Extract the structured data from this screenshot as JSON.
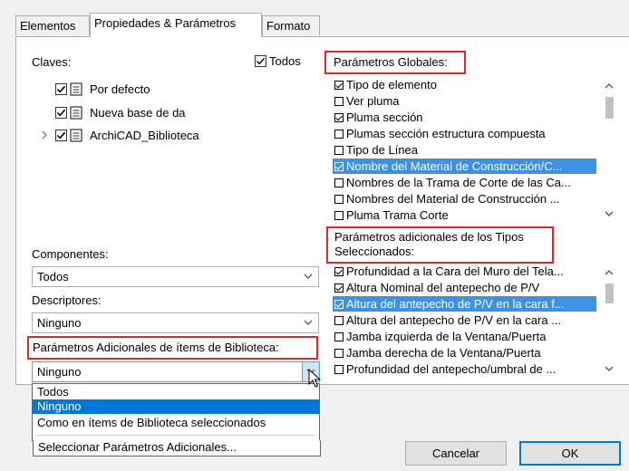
{
  "tabs": [
    {
      "label": "Elementos",
      "active": false
    },
    {
      "label": "Propiedades & Parámetros",
      "active": true
    },
    {
      "label": "Formato",
      "active": false
    }
  ],
  "left": {
    "keys_label": "Claves:",
    "all_label": "Todos",
    "all_checked": true,
    "tree": [
      {
        "label": "Por defecto",
        "checked": true,
        "expandable": false
      },
      {
        "label": "Nueva base de da",
        "checked": true,
        "expandable": false
      },
      {
        "label": "ArchiCAD_Biblioteca",
        "checked": true,
        "expandable": true
      }
    ],
    "components_label": "Componentes:",
    "components_value": "Todos",
    "descriptors_label": "Descriptores:",
    "descriptors_value": "Ninguno",
    "additional_label": "Parámetros Adicionales de ítems de Biblioteca:",
    "additional_value": "Ninguno",
    "dropdown_options": [
      "Todos",
      "Ninguno",
      "Como en ítems de Biblioteca seleccionados",
      "Seleccionar Parámetros Adicionales..."
    ],
    "dropdown_selected_index": 1
  },
  "global_params": {
    "title": "Parámetros Globales:",
    "items": [
      {
        "label": "Tipo de elemento",
        "checked": true,
        "selected": false
      },
      {
        "label": "Ver pluma",
        "checked": false,
        "selected": false
      },
      {
        "label": "Pluma sección",
        "checked": true,
        "selected": false
      },
      {
        "label": "Plumas sección estructura compuesta",
        "checked": false,
        "selected": false
      },
      {
        "label": "Tipo de Línea",
        "checked": false,
        "selected": false
      },
      {
        "label": "Nombre del Material de Construcción/C...",
        "checked": true,
        "selected": true
      },
      {
        "label": "Nombres de la Trama de Corte de las Ca...",
        "checked": false,
        "selected": false
      },
      {
        "label": "Nombres del Material de Construcción ...",
        "checked": false,
        "selected": false
      },
      {
        "label": "Pluma Trama Corte",
        "checked": false,
        "selected": false
      }
    ]
  },
  "type_params": {
    "title_line1": "Parámetros adicionales de los Tipos",
    "title_line2": "Seleccionados:",
    "items": [
      {
        "label": "Profundidad a la Cara del Muro del Tela...",
        "checked": true,
        "selected": false
      },
      {
        "label": "Altura Nominal del antepecho de P/V",
        "checked": true,
        "selected": false
      },
      {
        "label": "Altura del antepecho de P/V en la cara f...",
        "checked": true,
        "selected": true
      },
      {
        "label": "Altura del antepecho de P/V en la cara ...",
        "checked": false,
        "selected": false
      },
      {
        "label": "Jamba izquierda de la Ventana/Puerta",
        "checked": false,
        "selected": false
      },
      {
        "label": "Jamba derecha de la Ventana/Puerta",
        "checked": false,
        "selected": false
      },
      {
        "label": "Profundidad del antepecho/umbral de ...",
        "checked": false,
        "selected": false
      }
    ]
  },
  "buttons": {
    "cancel": "Cancelar",
    "ok": "OK"
  }
}
